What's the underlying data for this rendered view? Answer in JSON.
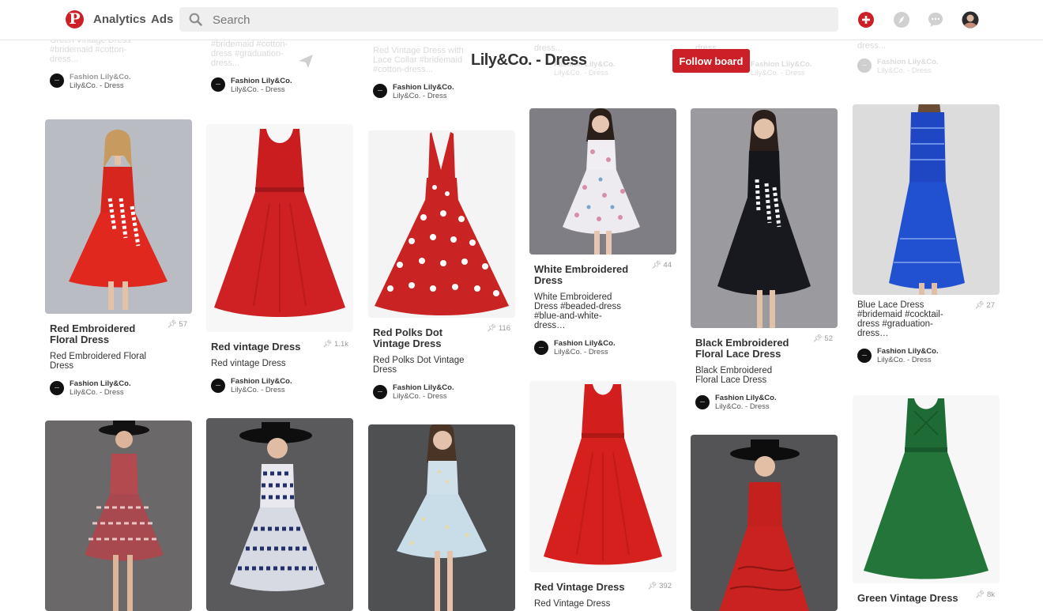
{
  "header": {
    "logo": "P",
    "analytics": "Analytics",
    "ads": "Ads",
    "search_placeholder": "Search"
  },
  "board": {
    "title": "Lily&Co. - Dress",
    "follow_label": "Follow board"
  },
  "ghost": {
    "col1_text": "Green Vintage Dress #bridemaid #cotton-dress...",
    "col1_name": "Fashion Lily&Co.",
    "col1_board": "Lily&Co. - Dress",
    "col2_text": "#bridemaid #cotton-dress #graduation-dress...",
    "col2_name": "Fashion Lily&Co.",
    "col2_board": "Lily&Co. - Dress",
    "col3_text": "Red Vintage Dress with Lace Collar #bridemaid #cotton-dress...",
    "col3_name": "Fashion Lily&Co.",
    "col3_board": "Lily&Co. - Dress",
    "col4_text": "dress...",
    "col4_name": "Fashion Lily&Co.",
    "col4_board": "Lily&Co. - Dress",
    "col5_text": "dress...",
    "col5_name": "Fashion Lily&Co.",
    "col5_board": "Lily&Co. - Dress",
    "col6_text": "dress...",
    "col6_name": "Fashion Lily&Co.",
    "col6_board": "Lily&Co. - Dress"
  },
  "pins": [
    {
      "title": "Red Embroidered Floral Dress",
      "saves": "57",
      "desc": "Red Embroidered Floral Dress",
      "name": "Fashion Lily&Co.",
      "board": "Lily&Co. - Dress"
    },
    {
      "title": "Red vintage Dress",
      "saves": "1.1k",
      "desc": "Red vintage Dress",
      "name": "Fashion Lily&Co.",
      "board": "Lily&Co. - Dress"
    },
    {
      "title": "Red Polks Dot Vintage Dress",
      "saves": "116",
      "desc": "Red Polks Dot Vintage Dress",
      "name": "Fashion Lily&Co.",
      "board": "Lily&Co. - Dress"
    },
    {
      "title": "White Embroidered Dress",
      "saves": "44",
      "desc": "White Embroidered Dress #beaded-dress #blue-and-white-dress…",
      "name": "Fashion Lily&Co.",
      "board": "Lily&Co. - Dress"
    },
    {
      "title": "Black Embroidered Floral Lace Dress",
      "saves": "52",
      "desc": "Black Embroidered Floral Lace Dress",
      "name": "Fashion Lily&Co.",
      "board": "Lily&Co. - Dress"
    },
    {
      "title": "",
      "saves": "27",
      "desc": "Blue Lace Dress #bridemaid #cocktail-dress #graduation-dress…",
      "name": "Fashion Lily&Co.",
      "board": "Lily&Co. - Dress"
    },
    {
      "title": "Red Vintage Dress",
      "saves": "392",
      "desc": "Red Vintage Dress"
    },
    {
      "title": "Green Vintage Dress",
      "saves": "8k"
    }
  ],
  "colors": {
    "brand": "#cb2027",
    "header_icon": "#cfcfcf"
  }
}
